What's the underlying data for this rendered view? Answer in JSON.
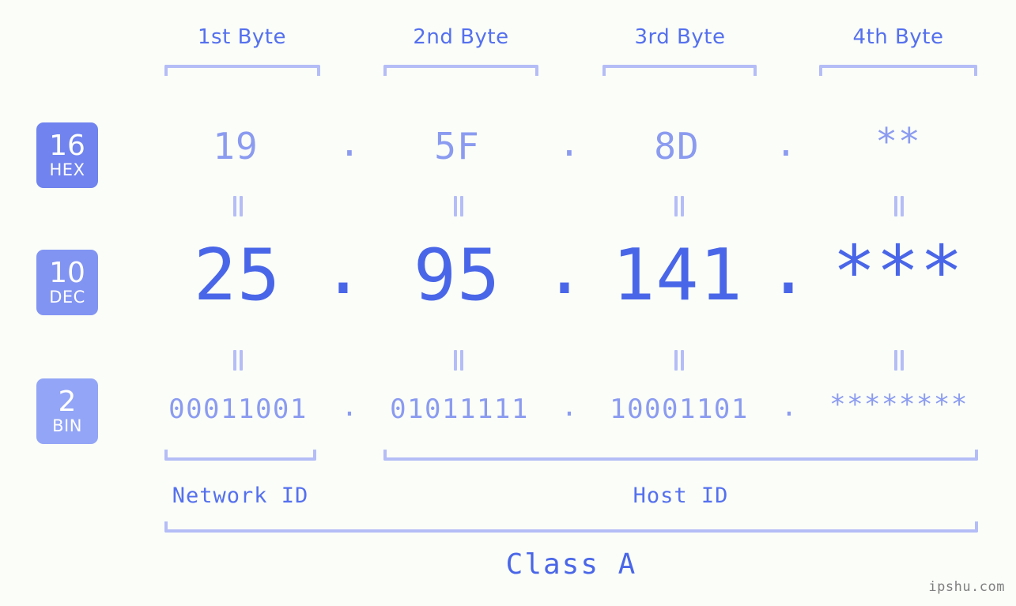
{
  "background_color": "#fafdf8",
  "accent_colors": {
    "strong_blue": "#4a66e8",
    "mid_blue": "#5570ee",
    "light_blue": "#8b9bf0",
    "pale_blue": "#b5bdf7",
    "badge_hex": "#7083ee",
    "badge_dec": "#8294f2",
    "badge_bin": "#93a5f6"
  },
  "headers": [
    {
      "label": "1st Byte"
    },
    {
      "label": "2nd Byte"
    },
    {
      "label": "3rd Byte"
    },
    {
      "label": "4th Byte"
    }
  ],
  "bases": [
    {
      "number": "16",
      "name": "HEX"
    },
    {
      "number": "10",
      "name": "DEC"
    },
    {
      "number": "2",
      "name": "BIN"
    }
  ],
  "separator": ".",
  "equals_symbol": "=",
  "rows": {
    "hex": {
      "base_number": "16",
      "base_name": "HEX",
      "values": [
        "19",
        "5F",
        "8D",
        "**"
      ]
    },
    "dec": {
      "base_number": "10",
      "base_name": "DEC",
      "values": [
        "25",
        "95",
        "141",
        "***"
      ]
    },
    "bin": {
      "base_number": "2",
      "base_name": "BIN",
      "values": [
        "00011001",
        "01011111",
        "10001101",
        "********"
      ]
    }
  },
  "sections": [
    {
      "label": "Network ID"
    },
    {
      "label": "Host ID"
    }
  ],
  "class": {
    "label": "Class A"
  },
  "watermark": {
    "text": "ipshu.com"
  }
}
